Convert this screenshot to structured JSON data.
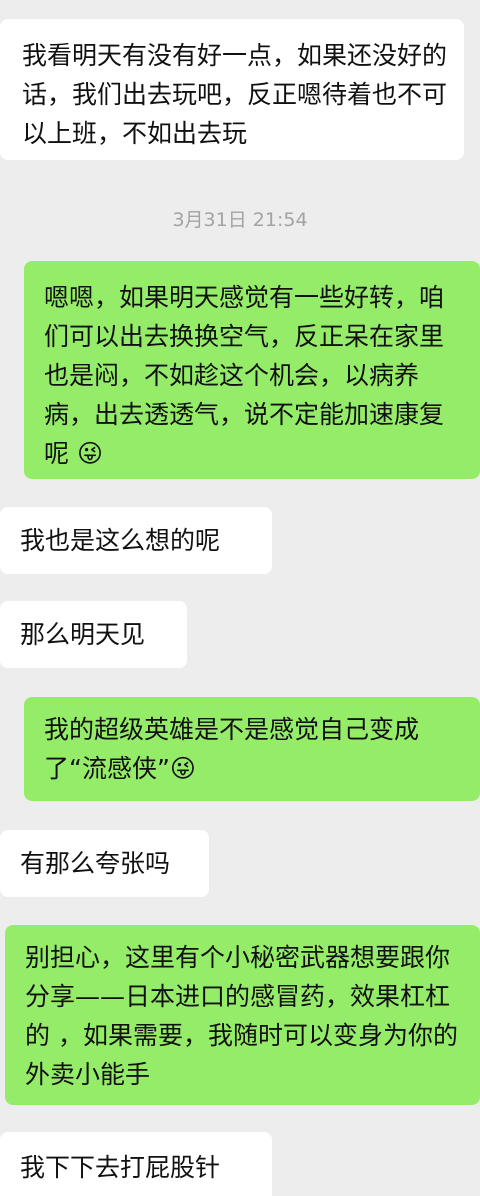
{
  "chat": {
    "messages": [
      {
        "side": "in",
        "text": "我看明天有没有好一点，如果还没好的话，我们出去玩吧，反正嗯待着也不可以上班，不如出去玩"
      },
      {
        "side": "out",
        "text": "嗯嗯，如果明天感觉有一些好转，咱们可以出去换换空气，反正呆在家里也是闷，不如趁这个机会，以病养病，出去透透气，说不定能加速康复呢 😜"
      },
      {
        "side": "in",
        "text": "我也是这么想的呢"
      },
      {
        "side": "in",
        "text": "那么明天见"
      },
      {
        "side": "out",
        "text": "我的超级英雄是不是感觉自己变成了“流感侠”😜"
      },
      {
        "side": "in",
        "text": "有那么夸张吗"
      },
      {
        "side": "out",
        "text": "别担心，这里有个小秘密武器想要跟你分享——日本进口的感冒药，效果杠杠的 ，如果需要，我随时可以变身为你的外卖小能手"
      },
      {
        "side": "in",
        "text": "我下下去打屁股针"
      }
    ],
    "timestamp": "3月31日 21:54"
  },
  "colors": {
    "background": "#ededed",
    "incoming_bubble": "#ffffff",
    "outgoing_bubble": "#95ec69",
    "timestamp_text": "#a3a3a3"
  }
}
